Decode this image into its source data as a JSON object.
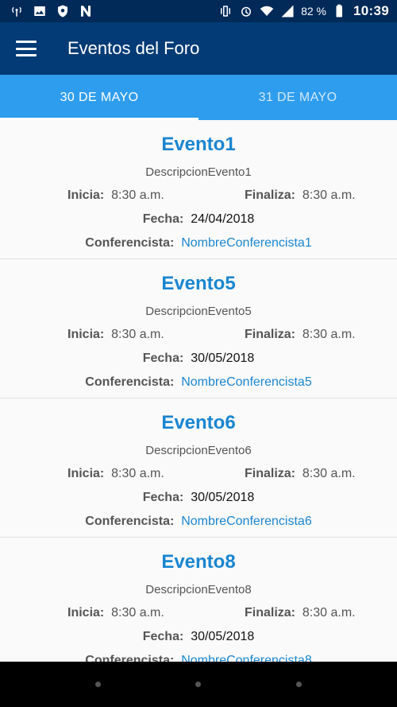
{
  "status_bar": {
    "left_icons": [
      "signal-tower-icon",
      "image-icon",
      "shield-icon",
      "n-logo-icon"
    ],
    "right_icons": [
      "vibrate-icon",
      "alarm-icon",
      "wifi-icon",
      "cell-signal-icon",
      "battery-icon"
    ],
    "battery": "82 %",
    "time": "10:39"
  },
  "app_bar": {
    "title": "Eventos del Foro",
    "menu_icon": "menu-icon"
  },
  "tabs": [
    {
      "label": "30 DE MAYO",
      "active": true
    },
    {
      "label": "31 DE MAYO",
      "active": false
    }
  ],
  "labels": {
    "start": "Inicia:",
    "end": "Finaliza:",
    "date": "Fecha:",
    "speaker": "Conferencista:"
  },
  "events": [
    {
      "title": "Evento1",
      "description": "DescripcionEvento1",
      "start": "8:30 a.m.",
      "end": "8:30 a.m.",
      "date": "24/04/2018",
      "speaker": "NombreConferencista1"
    },
    {
      "title": "Evento5",
      "description": "DescripcionEvento5",
      "start": "8:30 a.m.",
      "end": "8:30 a.m.",
      "date": "30/05/2018",
      "speaker": "NombreConferencista5"
    },
    {
      "title": "Evento6",
      "description": "DescripcionEvento6",
      "start": "8:30 a.m.",
      "end": "8:30 a.m.",
      "date": "30/05/2018",
      "speaker": "NombreConferencista6"
    },
    {
      "title": "Evento8",
      "description": "DescripcionEvento8",
      "start": "8:30 a.m.",
      "end": "8:30 a.m.",
      "date": "30/05/2018",
      "speaker": "NombreConferencista8"
    }
  ],
  "colors": {
    "status_bar": "#012a58",
    "app_bar": "#023b75",
    "tabs": "#2f9ded",
    "accent": "#1a86d0"
  }
}
